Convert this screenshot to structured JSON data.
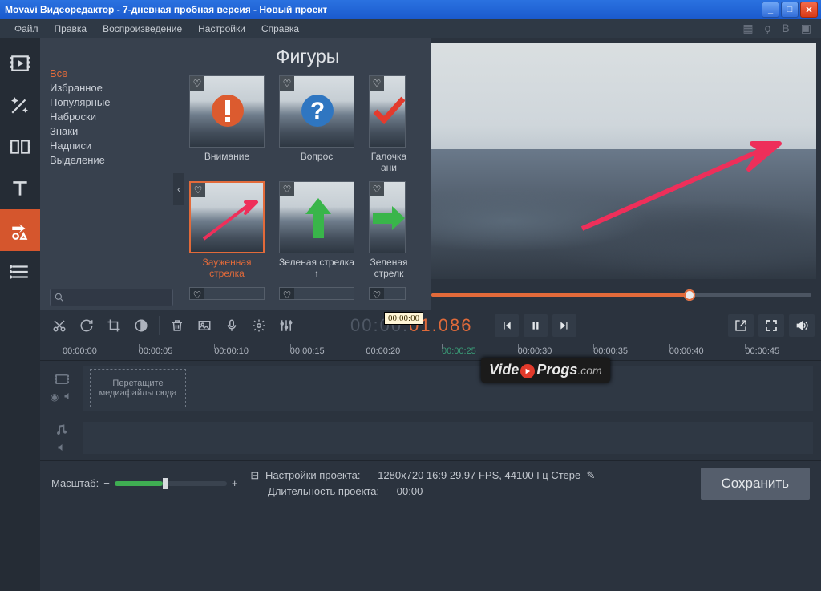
{
  "titlebar": {
    "title": "Movavi Видеоредактор - 7-дневная пробная версия - Новый проект"
  },
  "menubar": {
    "items": [
      "Файл",
      "Правка",
      "Воспроизведение",
      "Настройки",
      "Справка"
    ]
  },
  "sidebar": {
    "active_index": 4
  },
  "categories": {
    "items": [
      "Все",
      "Избранное",
      "Популярные",
      "Наброски",
      "Знаки",
      "Надписи",
      "Выделение"
    ],
    "active_index": 0
  },
  "gallery": {
    "title": "Фигуры",
    "cards": [
      {
        "label": "Внимание",
        "kind": "exclaim"
      },
      {
        "label": "Вопрос",
        "kind": "question"
      },
      {
        "label": "Галочка ани",
        "kind": "check"
      },
      {
        "label": "Зауженная стрелка",
        "kind": "arrow-red",
        "selected": true
      },
      {
        "label": "Зеленая стрелка ↑",
        "kind": "arrow-green-up"
      },
      {
        "label": "Зеленая стрелк",
        "kind": "arrow-green-right"
      }
    ]
  },
  "preview": {
    "slider_percent": 68
  },
  "toolbar": {
    "timecode_display": "00:00:01.086",
    "timecode_tooltip": "00:00:00"
  },
  "ruler": {
    "ticks": [
      "00:00:00",
      "00:00:05",
      "00:00:10",
      "00:00:15",
      "00:00:20",
      "00:00:25",
      "00:00:30",
      "00:00:35",
      "00:00:40",
      "00:00:45"
    ]
  },
  "timeline": {
    "dropzone_text": "Перетащите медиафайлы сюда"
  },
  "statusbar": {
    "zoom_label": "Масштаб:",
    "project_settings_label": "Настройки проекта:",
    "project_settings_value": "1280x720 16:9 29.97 FPS, 44100 Гц Стере",
    "duration_label": "Длительность проекта:",
    "duration_value": "00:00",
    "save_label": "Сохранить"
  },
  "watermark": {
    "pre": "Vide",
    "post": "Progs",
    "suffix": ".com"
  }
}
